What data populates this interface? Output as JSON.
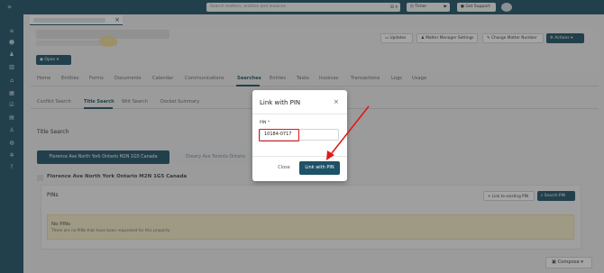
{
  "topbar": {
    "search_placeholder": "Search matters, entities and invoices",
    "search_filter_icon": "filter-icon",
    "timer_label": "Timer",
    "support_label": "Get Support"
  },
  "header": {
    "open_label": "Open",
    "updates_label": "Updates",
    "matter_manager_label": "Matter Manager Settings",
    "change_matter_label": "Change Matter Number",
    "actions_label": "Actions"
  },
  "nav": {
    "items": [
      "Home",
      "Entities",
      "Forms",
      "Documents",
      "Calendar",
      "Communications",
      "Searches",
      "Entries",
      "Tasks",
      "Invoices",
      "Transactions",
      "Logs",
      "Usage"
    ],
    "active": "Searches"
  },
  "subnav": {
    "items": [
      "Conflict Search",
      "Title Search",
      "Writ Search",
      "Docket Summary"
    ],
    "active": "Title Search"
  },
  "main": {
    "section_title": "Title Search",
    "property_tabs": [
      "Florence Ave North York Ontario M2N 1G5 Canada",
      "Drewry Ave Toronto Ontario"
    ],
    "property_heading": "Florence Ave North York Ontario M2N 1G5 Canada",
    "pins_label": "PINs",
    "link_existing_label": "Link to existing PIN",
    "search_pin_label": "Search PIN",
    "alert_title": "No PINs",
    "alert_text": "There are no PINs that have been requested for this property"
  },
  "compose_label": "Compose",
  "modal": {
    "title": "Link with PIN",
    "pin_label": "PIN *",
    "pin_value": "10184-0717",
    "close_label": "Close",
    "submit_label": "Link with PIN"
  },
  "colors": {
    "brand": "#1e5266",
    "annotation": "#e01818"
  }
}
